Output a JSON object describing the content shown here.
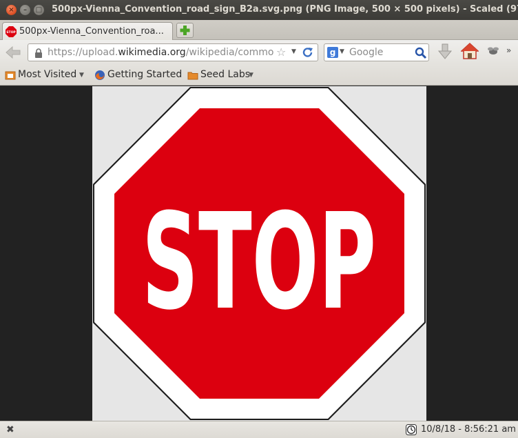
{
  "window": {
    "title": "500px-Vienna_Convention_road_sign_B2a.svg.png (PNG Image, 500 × 500 pixels) - Scaled (97"
  },
  "tab": {
    "title": "500px-Vienna_Convention_roa...",
    "favicon_text": "STOP"
  },
  "nav": {
    "url_prefix": "https://upload.",
    "url_domain": "wikimedia.org",
    "url_suffix": "/wikipedia/commo",
    "search_placeholder": "Google"
  },
  "bookmarks": {
    "most_visited": "Most Visited",
    "getting_started": "Getting Started",
    "seed_labs": "Seed Labs"
  },
  "image": {
    "sign_text": "STOP",
    "colors": {
      "red": "#dc000f",
      "white": "#ffffff",
      "border": "#1a1a1a",
      "background": "#e6e6e6"
    }
  },
  "status": {
    "datetime": "10/8/18 - 8:56:21 am"
  },
  "icons": {
    "close": "close-icon",
    "minimize": "minimize-icon",
    "maximize": "maximize-icon",
    "back": "back-arrow-icon",
    "lock": "lock-icon",
    "star": "bookmark-star-icon",
    "reload": "reload-icon",
    "google": "google-icon",
    "search": "magnifier-icon",
    "download": "download-icon",
    "home": "home-icon",
    "extension": "extension-icon",
    "clock": "clock-icon"
  }
}
